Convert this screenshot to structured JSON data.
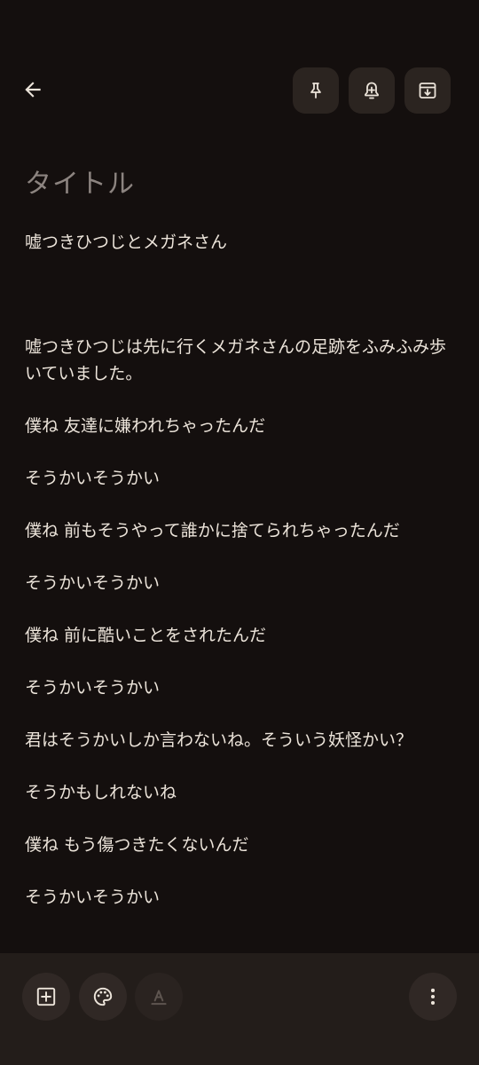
{
  "colors": {
    "background": "#140f0e",
    "button_bg": "#2b2420",
    "bottom_bar_bg": "#231d1a",
    "text": "#ece4da",
    "placeholder": "#8c8480",
    "disabled_icon": "#5e5550"
  },
  "toolbar": {
    "back_icon": "arrow-left-icon",
    "actions": [
      {
        "name": "pin",
        "icon": "pin-icon"
      },
      {
        "name": "reminder",
        "icon": "bell-plus-icon"
      },
      {
        "name": "archive",
        "icon": "archive-icon"
      }
    ]
  },
  "note": {
    "title_placeholder": "タイトル",
    "lines": [
      "嘘つきひつじとメガネさん",
      "嘘つきひつじは先に行くメガネさんの足跡をふみふみ歩いていました。",
      "僕ね 友達に嫌われちゃったんだ",
      "そうかいそうかい",
      "僕ね 前もそうやって誰かに捨てられちゃったんだ",
      "そうかいそうかい",
      "僕ね 前に酷いことをされたんだ",
      "そうかいそうかい",
      "君はそうかいしか言わないね。そういう妖怪かい？",
      "そうかもしれないね",
      "僕ね もう傷つきたくないんだ",
      "そうかいそうかい"
    ]
  },
  "bottom_bar": {
    "buttons": [
      {
        "name": "add",
        "icon": "add-box-icon"
      },
      {
        "name": "color",
        "icon": "palette-icon"
      },
      {
        "name": "text-format",
        "icon": "text-format-icon",
        "disabled": true
      }
    ],
    "more_icon": "more-vert-icon"
  }
}
